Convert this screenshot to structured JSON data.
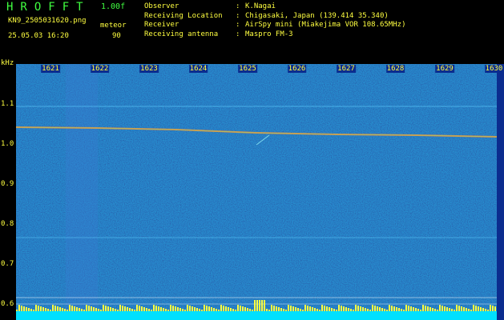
{
  "header": {
    "app_title": "HROFFT",
    "version": "1.00f",
    "filename": "KN9_2505031620.png",
    "timestamp": "25.05.03 16:20",
    "meteor_label": "meteor",
    "meteor_count": "90"
  },
  "info": [
    {
      "label": "Observer",
      "value": "K.Nagai"
    },
    {
      "label": "Receiving Location",
      "value": "Chigasaki, Japan (139.414 35.340)"
    },
    {
      "label": "Receiver",
      "value": "AirSpy mini (Miakejima VOR 108.65MHz)"
    },
    {
      "label": "Receiving antenna",
      "value": "Maspro FM-3"
    }
  ],
  "separator": ":",
  "axes": {
    "y_unit": "kHz",
    "x_ticks": [
      "1621",
      "1622",
      "1623",
      "1624",
      "1625",
      "1626",
      "1627",
      "1628",
      "1629",
      "1630"
    ],
    "y_ticks": [
      "1.1",
      "1.0",
      "0.9",
      "0.8",
      "0.7",
      "0.6"
    ]
  },
  "colors": {
    "background": "#000000",
    "waterfall": "#0b2c8e",
    "label": "#ffff40",
    "title": "#40ff40",
    "carrier": "#ff8030",
    "meteor_bar": "#00e0ff"
  }
}
